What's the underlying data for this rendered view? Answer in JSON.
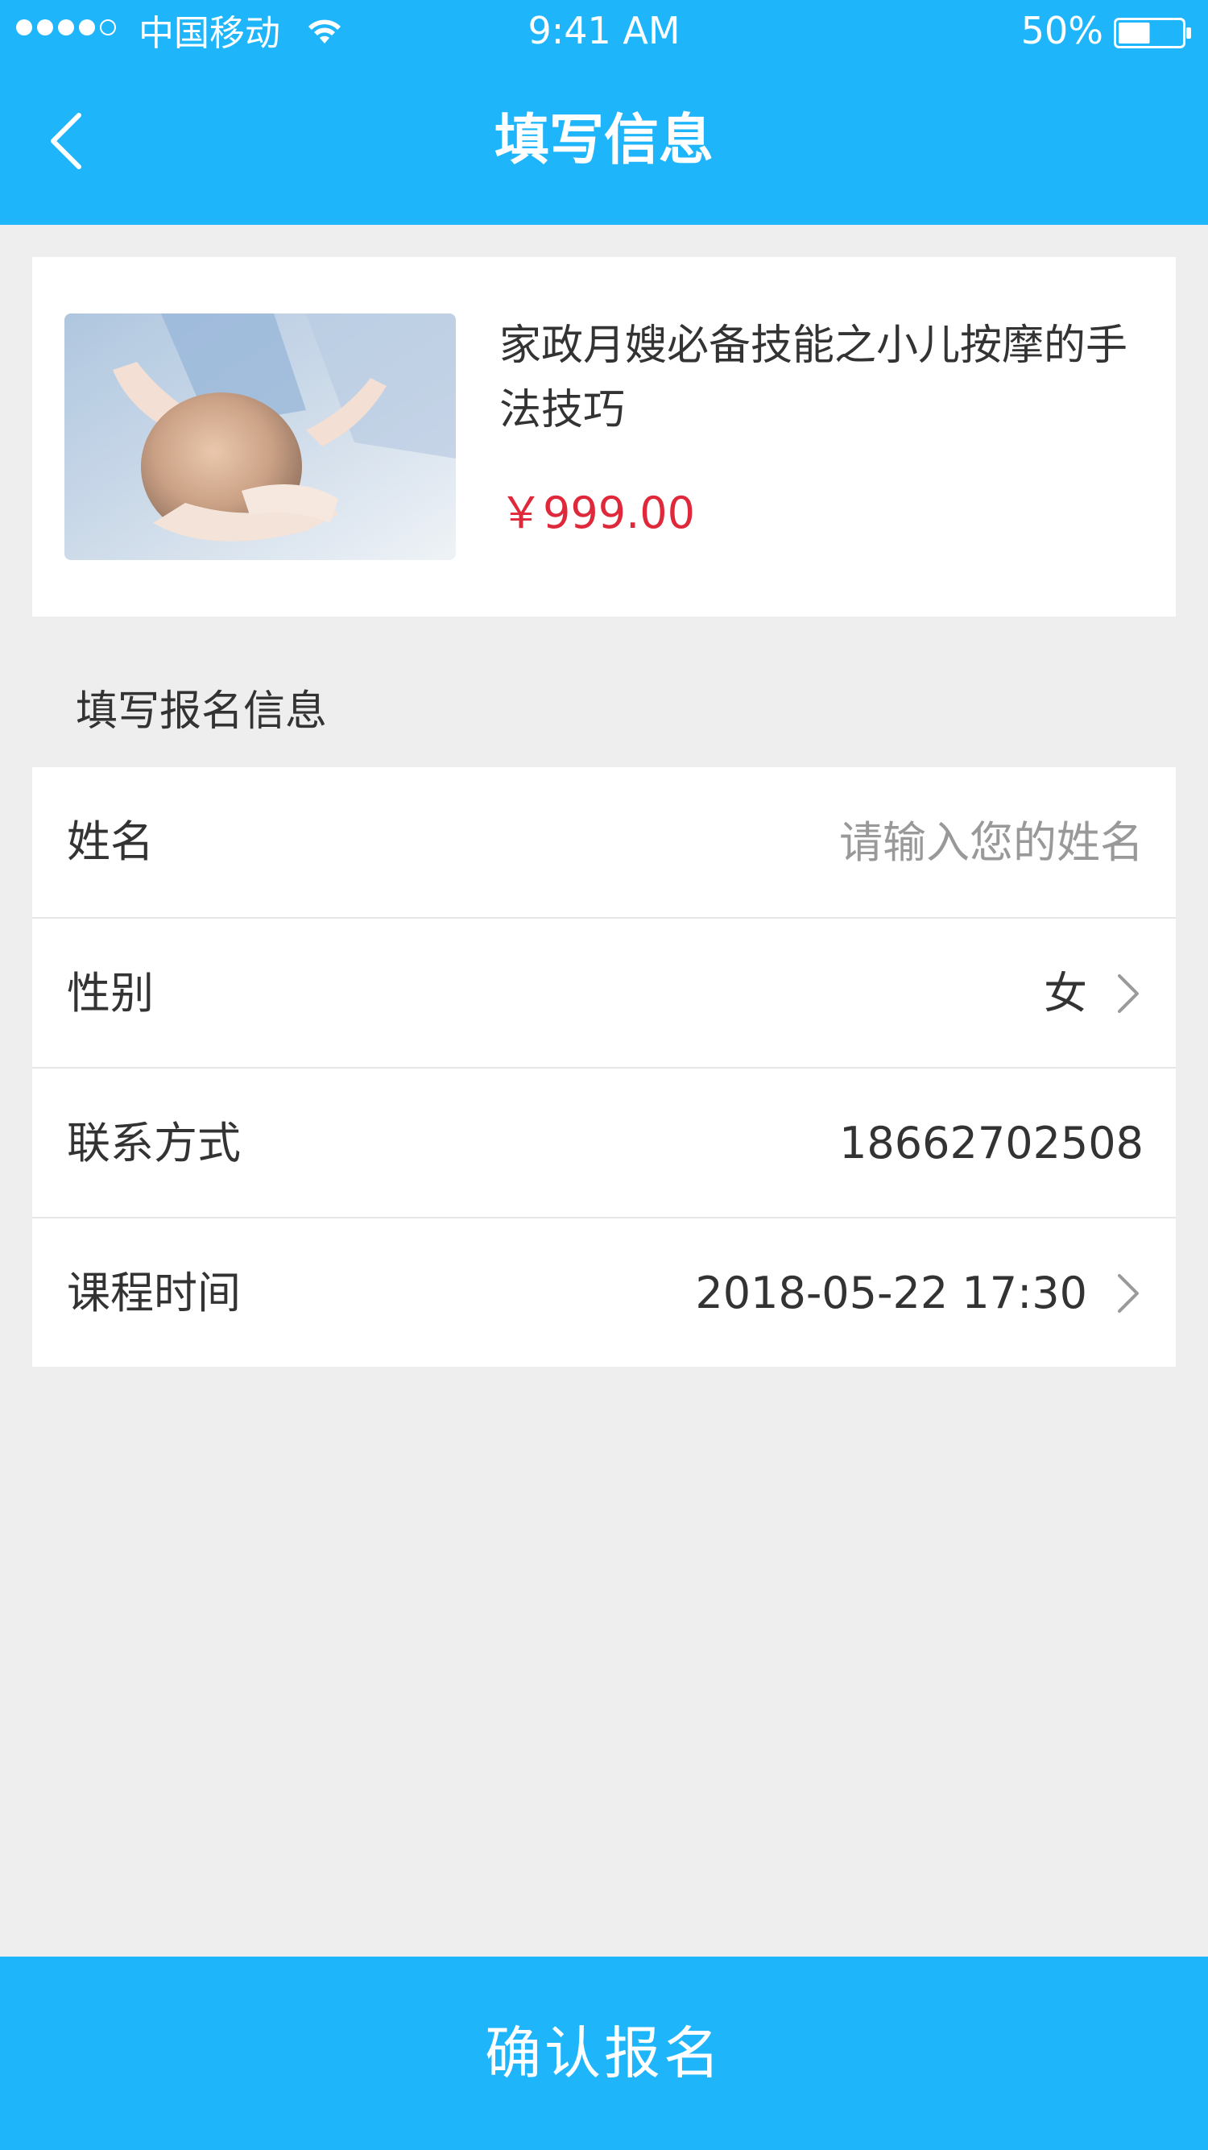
{
  "status_bar": {
    "carrier": "中国移动",
    "time": "9:41 AM",
    "battery_percent": "50%",
    "signal_bars": 4,
    "signal_total": 5,
    "battery_level": 0.5
  },
  "nav": {
    "title": "填写信息",
    "back_icon": "chevron-left-icon"
  },
  "course": {
    "title": "家政月嫂必备技能之小儿按摩的手法技巧",
    "price": "￥999.00",
    "price_color": "#e0283b"
  },
  "section": {
    "label": "填写报名信息"
  },
  "form": {
    "name": {
      "label": "姓名",
      "placeholder": "请输入您的姓名",
      "value": ""
    },
    "gender": {
      "label": "性别",
      "value": "女"
    },
    "contact": {
      "label": "联系方式",
      "value": "18662702508"
    },
    "course_time": {
      "label": "课程时间",
      "value": "2018-05-22 17:30"
    }
  },
  "confirm": {
    "label": "确认报名"
  },
  "colors": {
    "accent": "#1fb5fb",
    "background": "#eeeeee"
  }
}
